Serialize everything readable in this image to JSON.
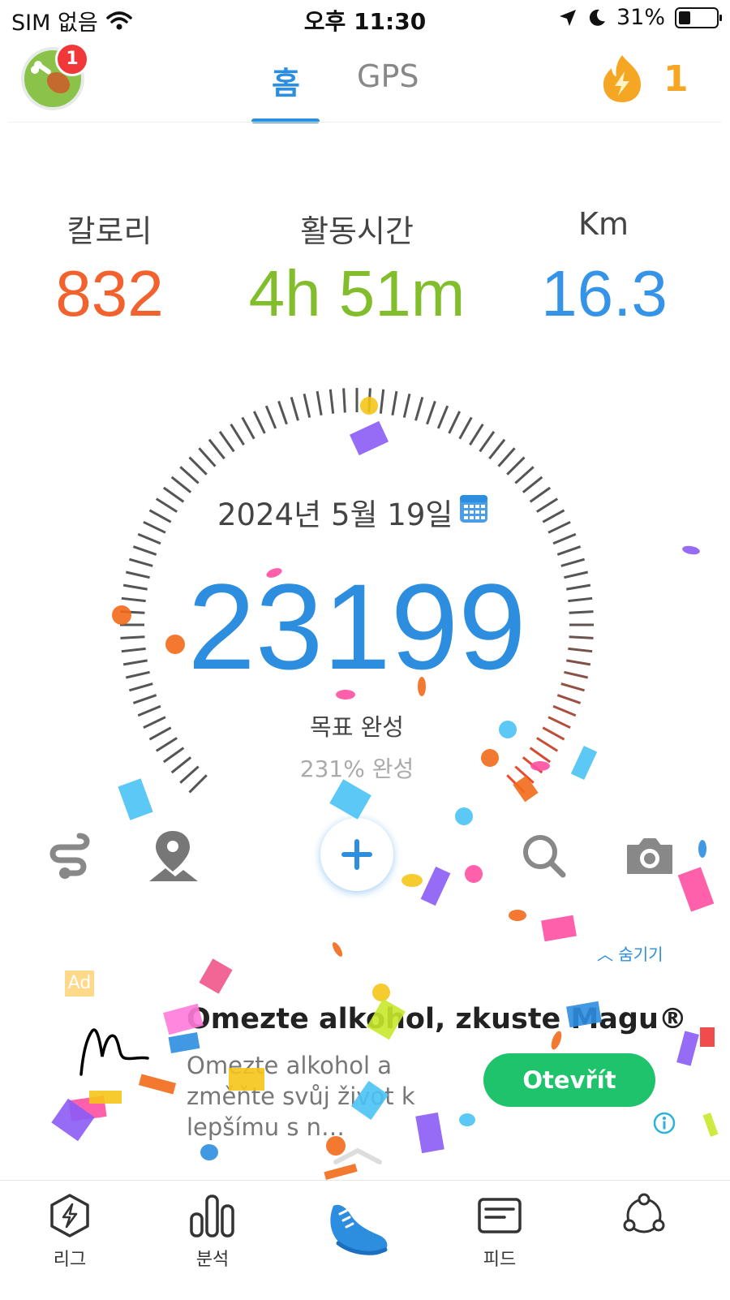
{
  "status_bar": {
    "carrier": "SIM 없음",
    "time": "오후 11:30",
    "battery": "31%"
  },
  "header": {
    "avatar_badge": "1",
    "tabs": [
      {
        "label": "홈",
        "active": true
      },
      {
        "label": "GPS",
        "active": false
      }
    ],
    "streak_count": "1"
  },
  "stats": [
    {
      "label": "칼로리",
      "value": "832",
      "color": "#f2622e"
    },
    {
      "label": "활동시간",
      "value": "4h 51m",
      "color": "#82be2c"
    },
    {
      "label": "Km",
      "value": "16.3",
      "color": "#3594e8"
    }
  ],
  "dial": {
    "date": "2024년 5월 19일",
    "steps": "23199",
    "goal_text": "목표 완성",
    "percent_text": "231% 완성"
  },
  "actions": [
    {
      "icon": "route-icon"
    },
    {
      "icon": "map-pin-icon"
    },
    {
      "icon": "plus-icon"
    },
    {
      "icon": "search-icon"
    },
    {
      "icon": "camera-icon"
    }
  ],
  "ad": {
    "hide_label": "숨기기",
    "tag": "Ad",
    "title": "Omezte alkohol, zkuste Magu®",
    "body": "Omezte alkohol a změňte svůj život k lepšímu s n…",
    "cta": "Otevřít"
  },
  "nav": [
    {
      "label": "리그",
      "icon": "league-icon"
    },
    {
      "label": "분석",
      "icon": "bar-chart-icon"
    },
    {
      "label": "",
      "icon": "shoe-icon"
    },
    {
      "label": "피드",
      "icon": "feed-icon"
    },
    {
      "label": "",
      "icon": "group-icon"
    }
  ],
  "colors": {
    "accent": "#2d8ee0",
    "cta_green": "#1ec36b",
    "badge_red": "#f0383a",
    "streak_orange": "#f5a623"
  }
}
